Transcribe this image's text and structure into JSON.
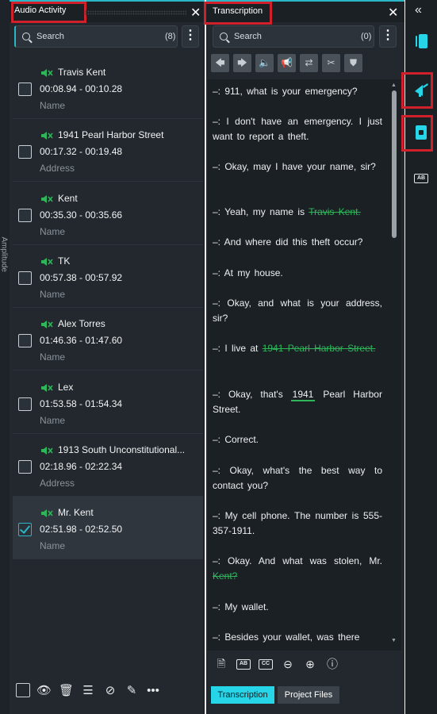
{
  "left_edge": {
    "label": "Amplitude"
  },
  "audio_activity": {
    "title": "Audio Activity",
    "search": {
      "placeholder": "Search",
      "count": "(8)"
    },
    "items": [
      {
        "name": "Travis Kent",
        "time": "00:08.94 - 00:10.28",
        "category": "Name",
        "checked": false
      },
      {
        "name": "1941 Pearl Harbor Street",
        "time": "00:17.32 - 00:19.48",
        "category": "Address",
        "checked": false
      },
      {
        "name": "Kent",
        "time": "00:35.30 - 00:35.66",
        "category": "Name",
        "checked": false
      },
      {
        "name": "TK",
        "time": "00:57.38 - 00:57.92",
        "category": "Name",
        "checked": false
      },
      {
        "name": "Alex Torres",
        "time": "01:46.36 - 01:47.60",
        "category": "Name",
        "checked": false
      },
      {
        "name": "Lex",
        "time": "01:53.58 - 01:54.34",
        "category": "Name",
        "checked": false
      },
      {
        "name": "1913 South Unconstitutional...",
        "time": "02:18.96 - 02:22.34",
        "category": "Address",
        "checked": false
      },
      {
        "name": "Mr. Kent",
        "time": "02:51.98 - 02:52.50",
        "category": "Name",
        "checked": true
      }
    ],
    "footer_icons": [
      "checkbox-icon",
      "eye-icon",
      "trash-icon",
      "list-add-icon",
      "ban-icon",
      "pencil-icon",
      "more-icon"
    ]
  },
  "transcription": {
    "title": "Transcription",
    "search": {
      "placeholder": "Search",
      "count": "(0)"
    },
    "toolbar_icons": [
      "arrow-left-icon",
      "arrow-right-icon",
      "mute-icon",
      "megaphone-icon",
      "shuffle-icon",
      "scissors-icon",
      "stamp-icon"
    ],
    "lines": {
      "l1": "–: 911, what is your emergency?",
      "l2": "–: I don't have an emergency. I just want to report a theft.",
      "l3": "–: Okay, may I have your name, sir?",
      "l4a": "–: Yeah, my name is ",
      "l4b": "Travis Kent.",
      "l5": "–: And where did this theft occur?",
      "l6": "–: At my house.",
      "l7": "–: Okay, and what is your address, sir?",
      "l8a": "–: I live at ",
      "l8b": "1941 Pearl Harbor Street.",
      "l9a": "–: Okay, that's ",
      "l9b": "1941",
      "l9c": " Pearl Harbor Street.",
      "l10": "–: Correct.",
      "l11": "–: Okay, what's the best way to contact you?",
      "l12": "–: My cell phone. The number is 555-357-1911.",
      "l13a": "–: Okay. And what was stolen, Mr. ",
      "l13b": "Kent?",
      "l14": "–: My wallet.",
      "l15": "–: Besides your wallet, was there"
    },
    "bottom_icons": [
      "file-add-icon",
      "ab-caption-icon",
      "cc-icon",
      "zoom-out-icon",
      "zoom-in-icon",
      "info-icon"
    ],
    "tabs": {
      "transcription": "Transcription",
      "project_files": "Project Files"
    }
  },
  "right_rail": {
    "badge": "AB"
  },
  "colors": {
    "accent": "#27d5e8",
    "highlight_green": "#2fb55a",
    "annotation_red": "#d0202b"
  }
}
